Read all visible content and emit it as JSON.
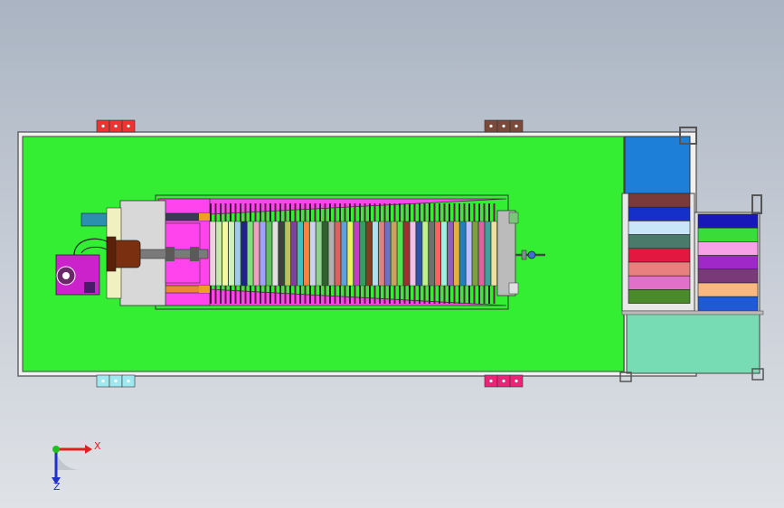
{
  "viewport": {
    "background_top": "#aab4c2",
    "background_bottom": "#dfe2e6"
  },
  "colors": {
    "base_plate": "#33ee33",
    "frame_outline": "#555555",
    "beam": "#3a3a55",
    "hopper": "#ff44ee",
    "motor": "#cc22cc",
    "cylinder": "#7a3010",
    "panel_blue": "#1d7fd8",
    "tank": "#77dcb3"
  },
  "mounting_feet": [
    {
      "id": "foot-top-left",
      "color": "#ee3333"
    },
    {
      "id": "foot-top-right",
      "color": "#7a4a3a"
    },
    {
      "id": "foot-bottom-left",
      "color": "#9fe8f0"
    },
    {
      "id": "foot-bottom-right",
      "color": "#ee2277"
    }
  ],
  "filter_plate_colors": [
    "#f0d0e0",
    "#c8e8b0",
    "#f8f8a0",
    "#d0f0c0",
    "#a0c8f0",
    "#202090",
    "#80e080",
    "#f0a0c0",
    "#a0a0ff",
    "#60c060",
    "#e0e0e0",
    "#404040",
    "#c0c060",
    "#8040a0",
    "#40c0c0",
    "#ff8040",
    "#d0d0f0",
    "#90d090",
    "#306030",
    "#b0b0b0",
    "#e06060",
    "#60a0e0",
    "#f0f060",
    "#c040c0",
    "#30a060",
    "#804020",
    "#b0e0f0",
    "#e08080",
    "#7070c0",
    "#d0a060",
    "#50e050",
    "#a03030",
    "#f0c0f0",
    "#3050b0",
    "#c0f090",
    "#707070",
    "#ff6060",
    "#a0f0e0",
    "#9060c0",
    "#e0b040",
    "#2080c0",
    "#c0c0ff",
    "#80a040",
    "#e060a0",
    "#40a0a0",
    "#f0e0a0"
  ],
  "drawer_stack_left": [
    "#7a3a3a",
    "#1530c8",
    "#c8e6f8",
    "#4a7a6a",
    "#e21840",
    "#e88080",
    "#e070c8",
    "#4a8a2a"
  ],
  "drawer_stack_right": [
    "#1818b8",
    "#3adc3a",
    "#f8a0e8",
    "#a028c8",
    "#7a3a7a",
    "#f8b880",
    "#1e5ad8"
  ],
  "axis_triad": {
    "x_label": "X",
    "z_label": "Z",
    "x_color": "#e02020",
    "y_color": "#20c020",
    "z_color": "#2030d0"
  }
}
